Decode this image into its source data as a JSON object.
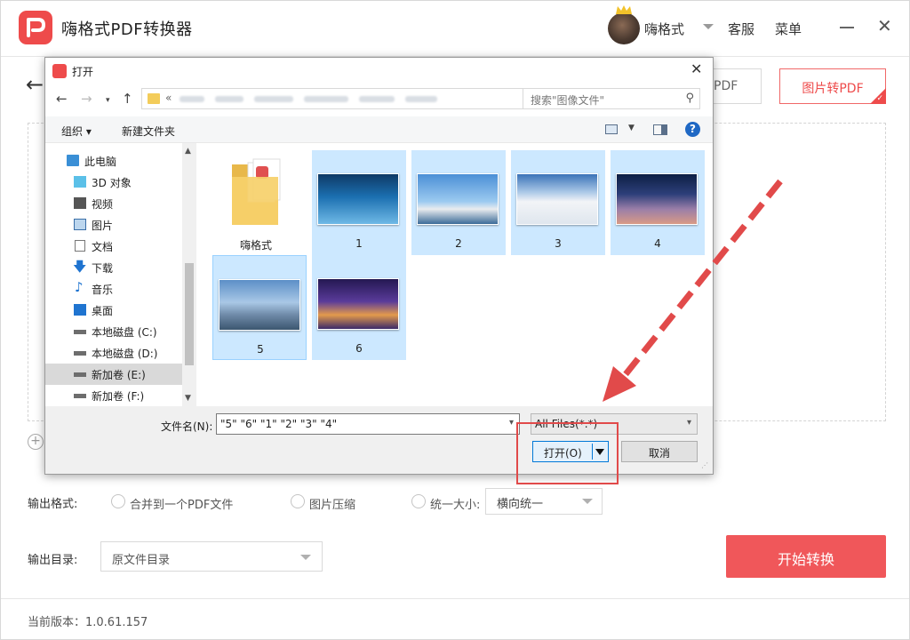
{
  "app": {
    "title": "嗨格式PDF转换器",
    "user_name": "嗨格式",
    "service_label": "客服",
    "menu_label": "菜单",
    "tab_partial_label": "PDF",
    "tab_active_label": "图片转PDF",
    "accent_color": "#ee4b4b"
  },
  "options": {
    "output_format_label": "输出格式:",
    "merge_label": "合并到一个PDF文件",
    "compress_label": "图片压缩",
    "unify_size_label": "统一大小:",
    "unify_size_value": "横向统一",
    "output_dir_label": "输出目录:",
    "output_dir_value": "原文件目录",
    "start_button": "开始转换"
  },
  "footer": {
    "version": "当前版本：1.0.61.157"
  },
  "dialog": {
    "title": "打开",
    "address_prefix": "«",
    "search_placeholder": "搜索\"图像文件\"",
    "toolbar": {
      "organize": "组织 ▾",
      "new_folder": "新建文件夹"
    },
    "nav_items": [
      {
        "label": "此电脑",
        "icon": "computer-icon"
      },
      {
        "label": "3D 对象",
        "icon": "cube-icon"
      },
      {
        "label": "视频",
        "icon": "video-icon"
      },
      {
        "label": "图片",
        "icon": "picture-icon"
      },
      {
        "label": "文档",
        "icon": "document-icon"
      },
      {
        "label": "下载",
        "icon": "download-icon"
      },
      {
        "label": "音乐",
        "icon": "music-icon"
      },
      {
        "label": "桌面",
        "icon": "desktop-icon"
      },
      {
        "label": "本地磁盘 (C:)",
        "icon": "drive-icon"
      },
      {
        "label": "本地磁盘 (D:)",
        "icon": "drive-icon"
      },
      {
        "label": "新加卷 (E:)",
        "icon": "drive-icon",
        "selected": true
      },
      {
        "label": "新加卷 (F:)",
        "icon": "drive-icon"
      }
    ],
    "files": [
      {
        "label": "嗨格式",
        "kind": "folder"
      },
      {
        "label": "1",
        "kind": "image"
      },
      {
        "label": "2",
        "kind": "image"
      },
      {
        "label": "3",
        "kind": "image"
      },
      {
        "label": "4",
        "kind": "image"
      },
      {
        "label": "5",
        "kind": "image"
      },
      {
        "label": "6",
        "kind": "image"
      }
    ],
    "filename_label": "文件名(N):",
    "filename_value": "\"5\" \"6\" \"1\" \"2\" \"3\" \"4\"",
    "file_type": "All Files(*.*)",
    "open_button": "打开(O)",
    "cancel_button": "取消"
  }
}
